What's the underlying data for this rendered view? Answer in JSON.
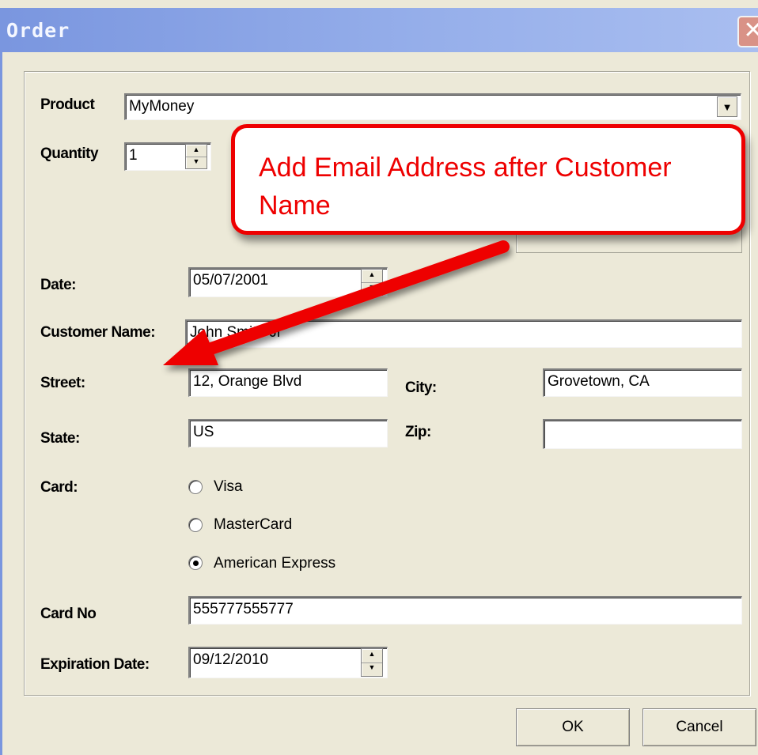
{
  "window": {
    "title": "Order",
    "close_glyph": "✕"
  },
  "form": {
    "product": {
      "label": "Product",
      "value": "MyMoney"
    },
    "quantity": {
      "label": "Quantity",
      "value": "1"
    },
    "date": {
      "label": "Date:",
      "value": "05/07/2001"
    },
    "customer_name": {
      "label": "Customer Name:",
      "value": "John Smith Jr"
    },
    "street": {
      "label": "Street:",
      "value": "12, Orange Blvd"
    },
    "city": {
      "label": "City:",
      "value": "Grovetown, CA"
    },
    "state": {
      "label": "State:",
      "value": "US"
    },
    "zip": {
      "label": "Zip:",
      "value": ""
    },
    "card": {
      "label": "Card:",
      "options": [
        {
          "label": "Visa",
          "selected": false
        },
        {
          "label": "MasterCard",
          "selected": false
        },
        {
          "label": "American Express",
          "selected": true
        }
      ]
    },
    "card_no": {
      "label": "Card No",
      "value": "555777555777"
    },
    "expiration_date": {
      "label": "Expiration Date:",
      "value": "09/12/2010"
    }
  },
  "buttons": {
    "ok": "OK",
    "cancel": "Cancel"
  },
  "annotation": {
    "text": "Add Email Address after Customer Name",
    "color": "#ee0000"
  },
  "icons": {
    "dropdown": "chevron-down-icon",
    "spin_up": "spin-up-icon",
    "spin_down": "spin-down-icon"
  }
}
